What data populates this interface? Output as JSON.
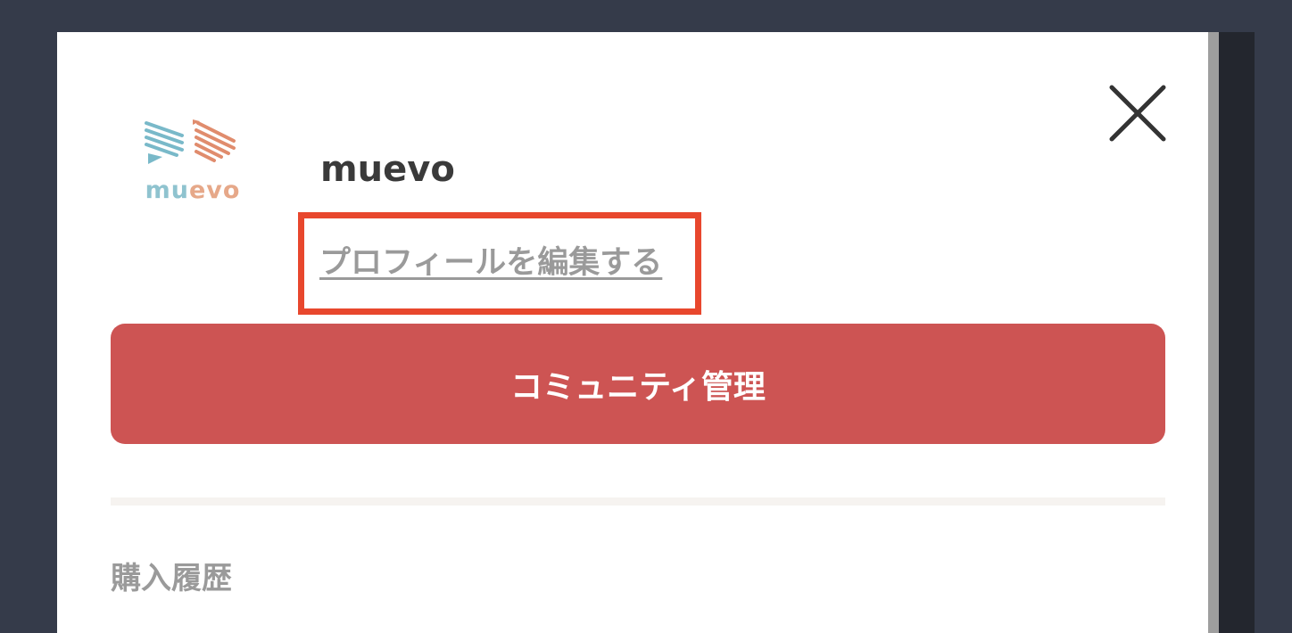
{
  "brand": {
    "logo_text_part1": "mu",
    "logo_text_part2": "evo",
    "color_teal": "#79b9c9",
    "color_coral": "#e08c6d"
  },
  "profile": {
    "username": "muevo",
    "edit_link_label": "プロフィールを編集する"
  },
  "actions": {
    "community_manage_label": "コミュニティ管理",
    "accent_color": "#cd5453"
  },
  "menu": {
    "purchase_history_label": "購入履歴"
  },
  "icons": {
    "close": "close-icon",
    "logo": "muevo-logo-icon"
  },
  "highlight": {
    "color": "#e8472d"
  }
}
